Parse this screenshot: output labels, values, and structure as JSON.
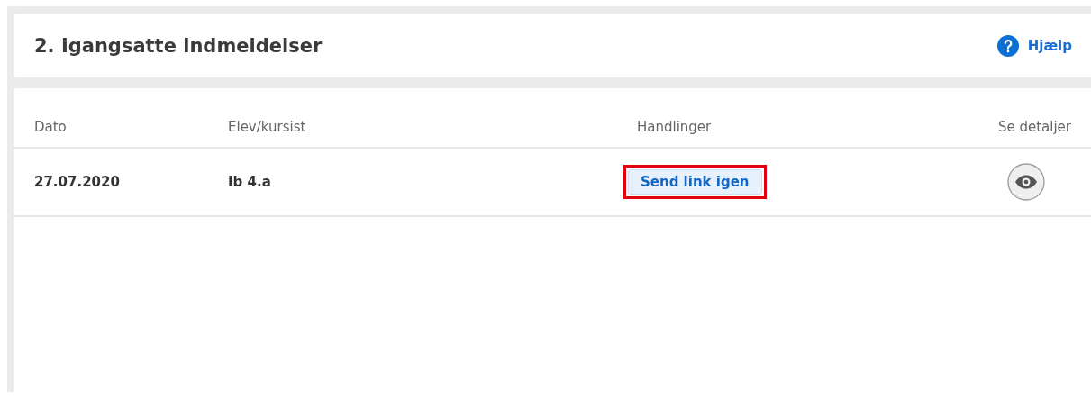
{
  "header": {
    "title": "2. Igangsatte indmeldelser",
    "help_link": "Hjælp"
  },
  "table": {
    "columns": [
      "Dato",
      "Elev/kursist",
      "Handlinger",
      "Se detaljer"
    ],
    "rows": [
      {
        "date": "27.07.2020",
        "student": "Ib 4.a",
        "action": "Send link igen",
        "action_highlighted": true
      }
    ]
  }
}
